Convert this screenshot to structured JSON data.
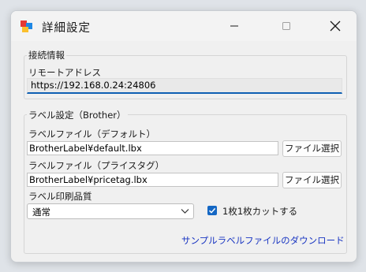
{
  "window": {
    "title": "詳細設定",
    "icon": "app-icon"
  },
  "connection": {
    "group_title": "接続情報",
    "remote_address_label": "リモートアドレス",
    "remote_address_value": "https://192.168.0.24:24806"
  },
  "label_settings": {
    "group_title": "ラベル設定（Brother）",
    "default_file_label": "ラベルファイル（デフォルト）",
    "default_file_value": "BrotherLabel¥default.lbx",
    "default_file_button": "ファイル選択",
    "pricetag_file_label": "ラベルファイル（プライスタグ）",
    "pricetag_file_value": "BrotherLabel¥pricetag.lbx",
    "pricetag_file_button": "ファイル選択",
    "print_quality_label": "ラベル印刷品質",
    "print_quality_value": "通常",
    "cut_checkbox_label": "1枚1枚カットする",
    "cut_checkbox_checked": true,
    "sample_download_link": "サンプルラベルファイルのダウンロード"
  },
  "colors": {
    "accent": "#1467c4",
    "link": "#1a36c2"
  }
}
